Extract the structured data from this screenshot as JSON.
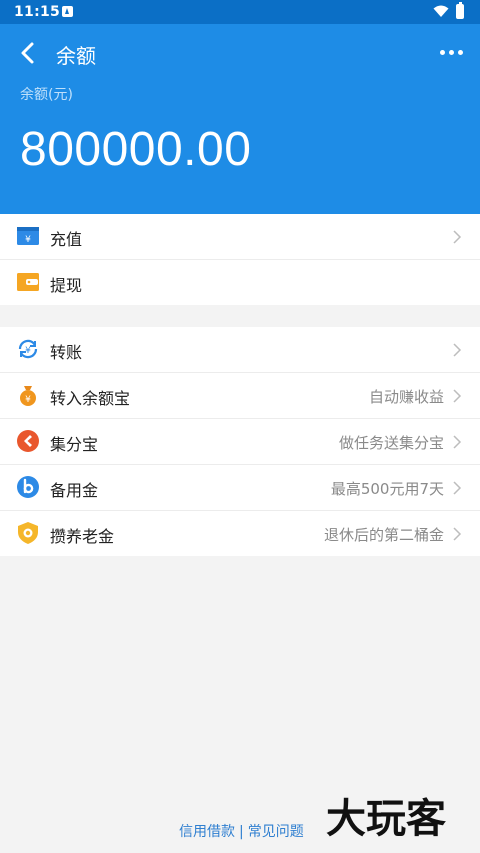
{
  "status": {
    "time": "11:15"
  },
  "header": {
    "title": "余额",
    "balance_label": "余额(元)",
    "balance": "800000.00"
  },
  "group1": [
    {
      "label": "充值",
      "hint": ""
    },
    {
      "label": "提现",
      "hint": ""
    }
  ],
  "group2": [
    {
      "label": "转账",
      "hint": ""
    },
    {
      "label": "转入余额宝",
      "hint": "自动赚收益"
    },
    {
      "label": "集分宝",
      "hint": "做任务送集分宝"
    },
    {
      "label": "备用金",
      "hint": "最高500元用7天"
    },
    {
      "label": "攒养老金",
      "hint": "退休后的第二桶金"
    }
  ],
  "footer": {
    "credit_link": "信用借款",
    "separator": "|",
    "faq_link": "常见问题"
  },
  "watermark_text": "大玩客",
  "colors": {
    "header_bg": "#1e8ce6",
    "status_bg": "#0b6fc6",
    "link": "#2f7fd0"
  }
}
